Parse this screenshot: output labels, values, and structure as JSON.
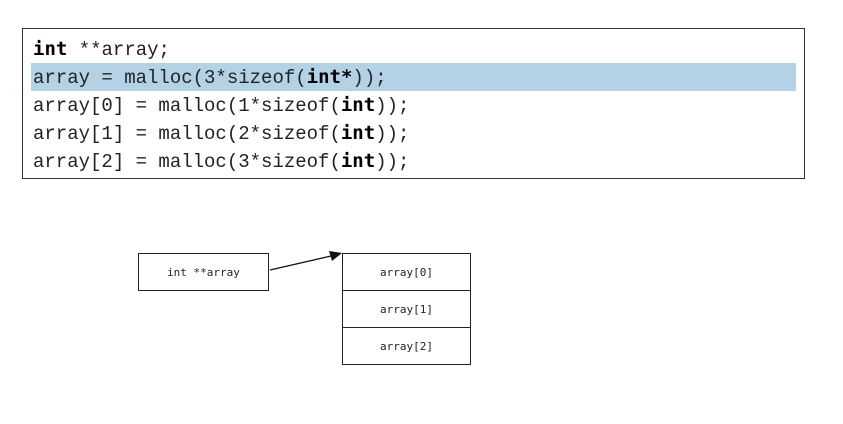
{
  "code": {
    "lines": [
      {
        "parts": [
          {
            "t": "int",
            "b": true
          },
          {
            "t": " **array;",
            "b": false
          }
        ],
        "highlight": false
      },
      {
        "parts": [
          {
            "t": "array = malloc(3*sizeof(",
            "b": false
          },
          {
            "t": "int*",
            "b": true
          },
          {
            "t": "));",
            "b": false
          }
        ],
        "highlight": true
      },
      {
        "parts": [
          {
            "t": "array[0] = malloc(1*sizeof(",
            "b": false
          },
          {
            "t": "int",
            "b": true
          },
          {
            "t": "));",
            "b": false
          }
        ],
        "highlight": false
      },
      {
        "parts": [
          {
            "t": "array[1] = malloc(2*sizeof(",
            "b": false
          },
          {
            "t": "int",
            "b": true
          },
          {
            "t": "));",
            "b": false
          }
        ],
        "highlight": false
      },
      {
        "parts": [
          {
            "t": "array[2] = malloc(3*sizeof(",
            "b": false
          },
          {
            "t": "int",
            "b": true
          },
          {
            "t": "));",
            "b": false
          }
        ],
        "highlight": false
      }
    ],
    "highlight_color": "#b4d2e6"
  },
  "diagram": {
    "pointer_label": "int **array",
    "array_cells": [
      "array[0]",
      "array[1]",
      "array[2]"
    ]
  }
}
